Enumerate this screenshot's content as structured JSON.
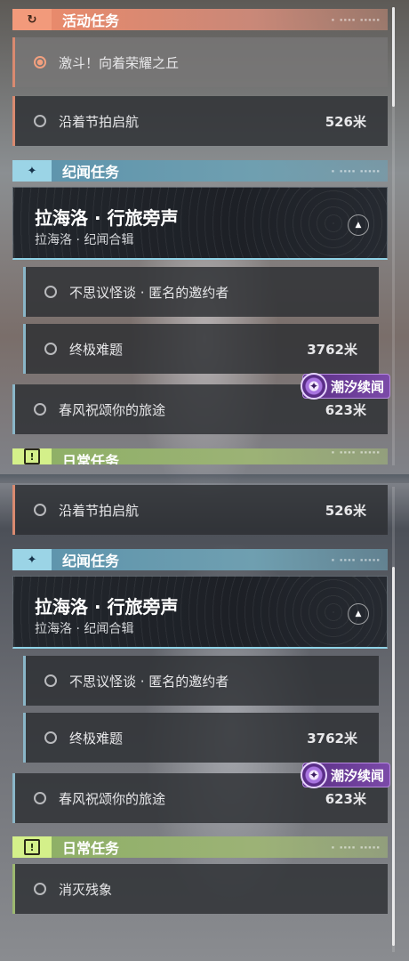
{
  "sections": {
    "activity": {
      "title": "活动任务",
      "icon": "refresh-icon",
      "color": "#f29a7b"
    },
    "chronicle": {
      "title": "纪闻任务",
      "icon": "sparkle-icon",
      "color": "#9bd4e6"
    },
    "daily": {
      "title": "日常任务",
      "icon": "alert-icon",
      "color": "#d4f08a"
    }
  },
  "header_tag": "▪ ▪▪▪▪ ▪▪▪▪▪",
  "activity_tasks": [
    {
      "label": "激斗！向着荣耀之丘",
      "active": true
    },
    {
      "label": "沿着节拍启航",
      "distance": "526米"
    }
  ],
  "chronicle_card": {
    "title": "拉海洛 · 行旅旁声",
    "subtitle": "拉海洛 · 纪闻合辑",
    "toggle_glyph": "▲"
  },
  "chronicle_subtasks": [
    {
      "label": "不思议怪谈 · 匿名的邀约者"
    },
    {
      "label": "终极难题",
      "distance": "3762米"
    }
  ],
  "spring_task": {
    "label": "春风祝颂你的旅途",
    "distance": "623米"
  },
  "tide_badge": {
    "text": "潮汐续闻",
    "glyph": "✦"
  },
  "daily_tasks": [
    {
      "label": "消灭残象"
    }
  ],
  "icons": {
    "refresh": "↻",
    "sparkle": "✦",
    "alert": "!"
  },
  "colors": {
    "activity_bar": "#d98a70",
    "chronicle_bar": "#8ab6c8",
    "daily_bar": "#9cb870"
  }
}
